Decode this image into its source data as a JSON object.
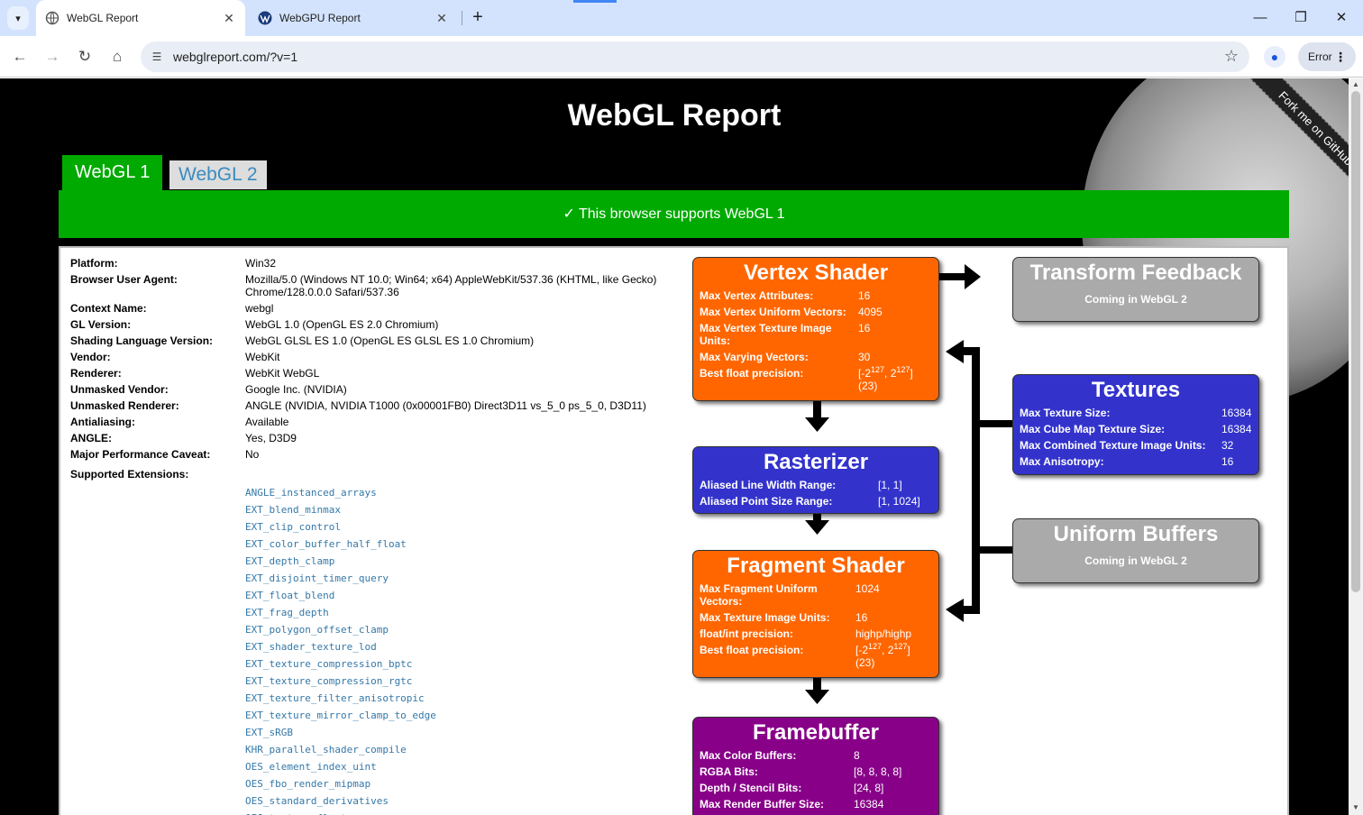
{
  "browser": {
    "tabs": [
      {
        "title": "WebGL Report",
        "active": true
      },
      {
        "title": "WebGPU Report",
        "active": false
      }
    ],
    "url": "webglreport.com/?v=1",
    "profile_button": "Error"
  },
  "page": {
    "title": "WebGL Report",
    "fork_ribbon": "Fork me on GitHub",
    "version_tabs": [
      "WebGL 1",
      "WebGL 2"
    ],
    "support_banner": "✓ This browser supports WebGL 1",
    "info": [
      {
        "label": "Platform:",
        "value": "Win32"
      },
      {
        "label": "Browser User Agent:",
        "value": "Mozilla/5.0 (Windows NT 10.0; Win64; x64) AppleWebKit/537.36 (KHTML, like Gecko) Chrome/128.0.0.0 Safari/537.36"
      },
      {
        "label": "Context Name:",
        "value": "webgl"
      },
      {
        "label": "GL Version:",
        "value": "WebGL 1.0 (OpenGL ES 2.0 Chromium)"
      },
      {
        "label": "Shading Language Version:",
        "value": "WebGL GLSL ES 1.0 (OpenGL ES GLSL ES 1.0 Chromium)"
      },
      {
        "label": "Vendor:",
        "value": "WebKit"
      },
      {
        "label": "Renderer:",
        "value": "WebKit WebGL"
      },
      {
        "label": "Unmasked Vendor:",
        "value": "Google Inc. (NVIDIA)"
      },
      {
        "label": "Unmasked Renderer:",
        "value": "ANGLE (NVIDIA, NVIDIA T1000 (0x00001FB0) Direct3D11 vs_5_0 ps_5_0, D3D11)"
      },
      {
        "label": "Antialiasing:",
        "value": "Available"
      },
      {
        "label": "ANGLE:",
        "value": "Yes, D3D9"
      },
      {
        "label": "Major Performance Caveat:",
        "value": "No"
      }
    ],
    "extensions_label": "Supported Extensions:",
    "extensions": [
      "ANGLE_instanced_arrays",
      "EXT_blend_minmax",
      "EXT_clip_control",
      "EXT_color_buffer_half_float",
      "EXT_depth_clamp",
      "EXT_disjoint_timer_query",
      "EXT_float_blend",
      "EXT_frag_depth",
      "EXT_polygon_offset_clamp",
      "EXT_shader_texture_lod",
      "EXT_texture_compression_bptc",
      "EXT_texture_compression_rgtc",
      "EXT_texture_filter_anisotropic",
      "EXT_texture_mirror_clamp_to_edge",
      "EXT_sRGB",
      "KHR_parallel_shader_compile",
      "OES_element_index_uint",
      "OES_fbo_render_mipmap",
      "OES_standard_derivatives",
      "OES_texture_float"
    ]
  },
  "pipeline": {
    "vertex_shader": {
      "title": "Vertex Shader",
      "rows": [
        {
          "label": "Max Vertex Attributes:",
          "value": "16"
        },
        {
          "label": "Max Vertex Uniform Vectors:",
          "value": "4095"
        },
        {
          "label": "Max Vertex Texture Image Units:",
          "value": "16"
        },
        {
          "label": "Max Varying Vectors:",
          "value": "30"
        },
        {
          "label": "Best float precision:",
          "value": "[-2127, 2127] (23)"
        }
      ]
    },
    "rasterizer": {
      "title": "Rasterizer",
      "rows": [
        {
          "label": "Aliased Line Width Range:",
          "value": "[1, 1]"
        },
        {
          "label": "Aliased Point Size Range:",
          "value": "[1, 1024]"
        }
      ]
    },
    "fragment_shader": {
      "title": "Fragment Shader",
      "rows": [
        {
          "label": "Max Fragment Uniform Vectors:",
          "value": "1024"
        },
        {
          "label": "Max Texture Image Units:",
          "value": "16"
        },
        {
          "label": "float/int precision:",
          "value": "highp/highp"
        },
        {
          "label": "Best float precision:",
          "value": "[-2127, 2127] (23)"
        }
      ]
    },
    "framebuffer": {
      "title": "Framebuffer",
      "rows": [
        {
          "label": "Max Color Buffers:",
          "value": "8"
        },
        {
          "label": "RGBA Bits:",
          "value": "[8, 8, 8, 8]"
        },
        {
          "label": "Depth / Stencil Bits:",
          "value": "[24, 8]"
        },
        {
          "label": "Max Render Buffer Size:",
          "value": "16384"
        }
      ]
    },
    "transform_feedback": {
      "title": "Transform Feedback",
      "note": "Coming in WebGL 2"
    },
    "textures": {
      "title": "Textures",
      "rows": [
        {
          "label": "Max Texture Size:",
          "value": "16384"
        },
        {
          "label": "Max Cube Map Texture Size:",
          "value": "16384"
        },
        {
          "label": "Max Combined Texture Image Units:",
          "value": "32"
        },
        {
          "label": "Max Anisotropy:",
          "value": "16"
        }
      ]
    },
    "uniform_buffers": {
      "title": "Uniform Buffers",
      "note": "Coming in WebGL 2"
    }
  },
  "colors": {
    "support_green": "#00aa00",
    "shader_orange": "#ff6600",
    "raster_blue": "#3333cc",
    "framebuffer_purple": "#880088",
    "disabled_gray": "#aaaaaa",
    "link_blue": "#3478a8"
  }
}
